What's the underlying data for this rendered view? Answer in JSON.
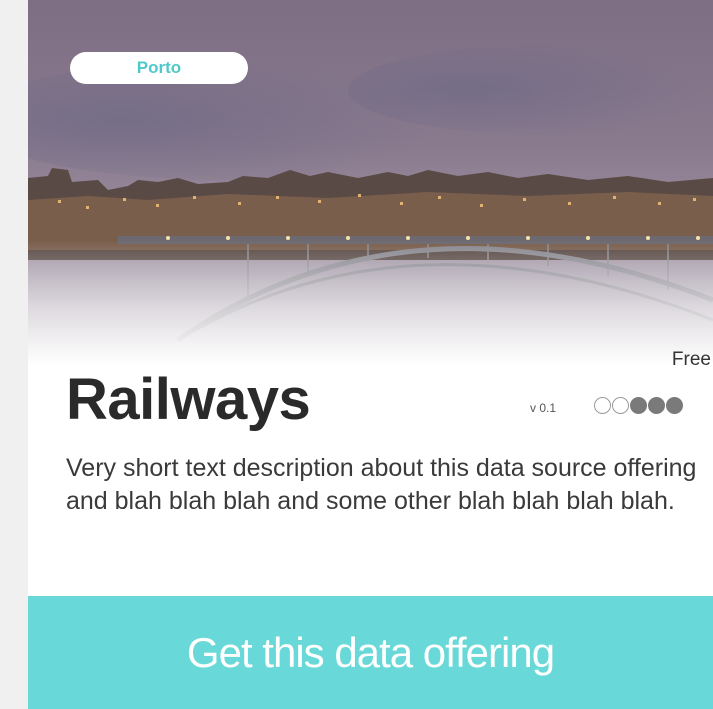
{
  "card": {
    "location_tag": "Porto",
    "price_label": "Free",
    "title": "Railways",
    "version": "v 0.1",
    "rating": {
      "value": 3,
      "max": 5
    },
    "description": "Very short text description about this data source offering and blah blah blah and some other blah blah blah blah.",
    "cta_label": "Get this data offering"
  },
  "colors": {
    "accent": "#69d8d8",
    "tag_text": "#4fc9c9",
    "title": "#2a2a2a",
    "rating_filled": "#7a7a7a"
  },
  "icons": {
    "hero_image": "porto-bridge-night-photo",
    "rating": "rating-dots"
  }
}
